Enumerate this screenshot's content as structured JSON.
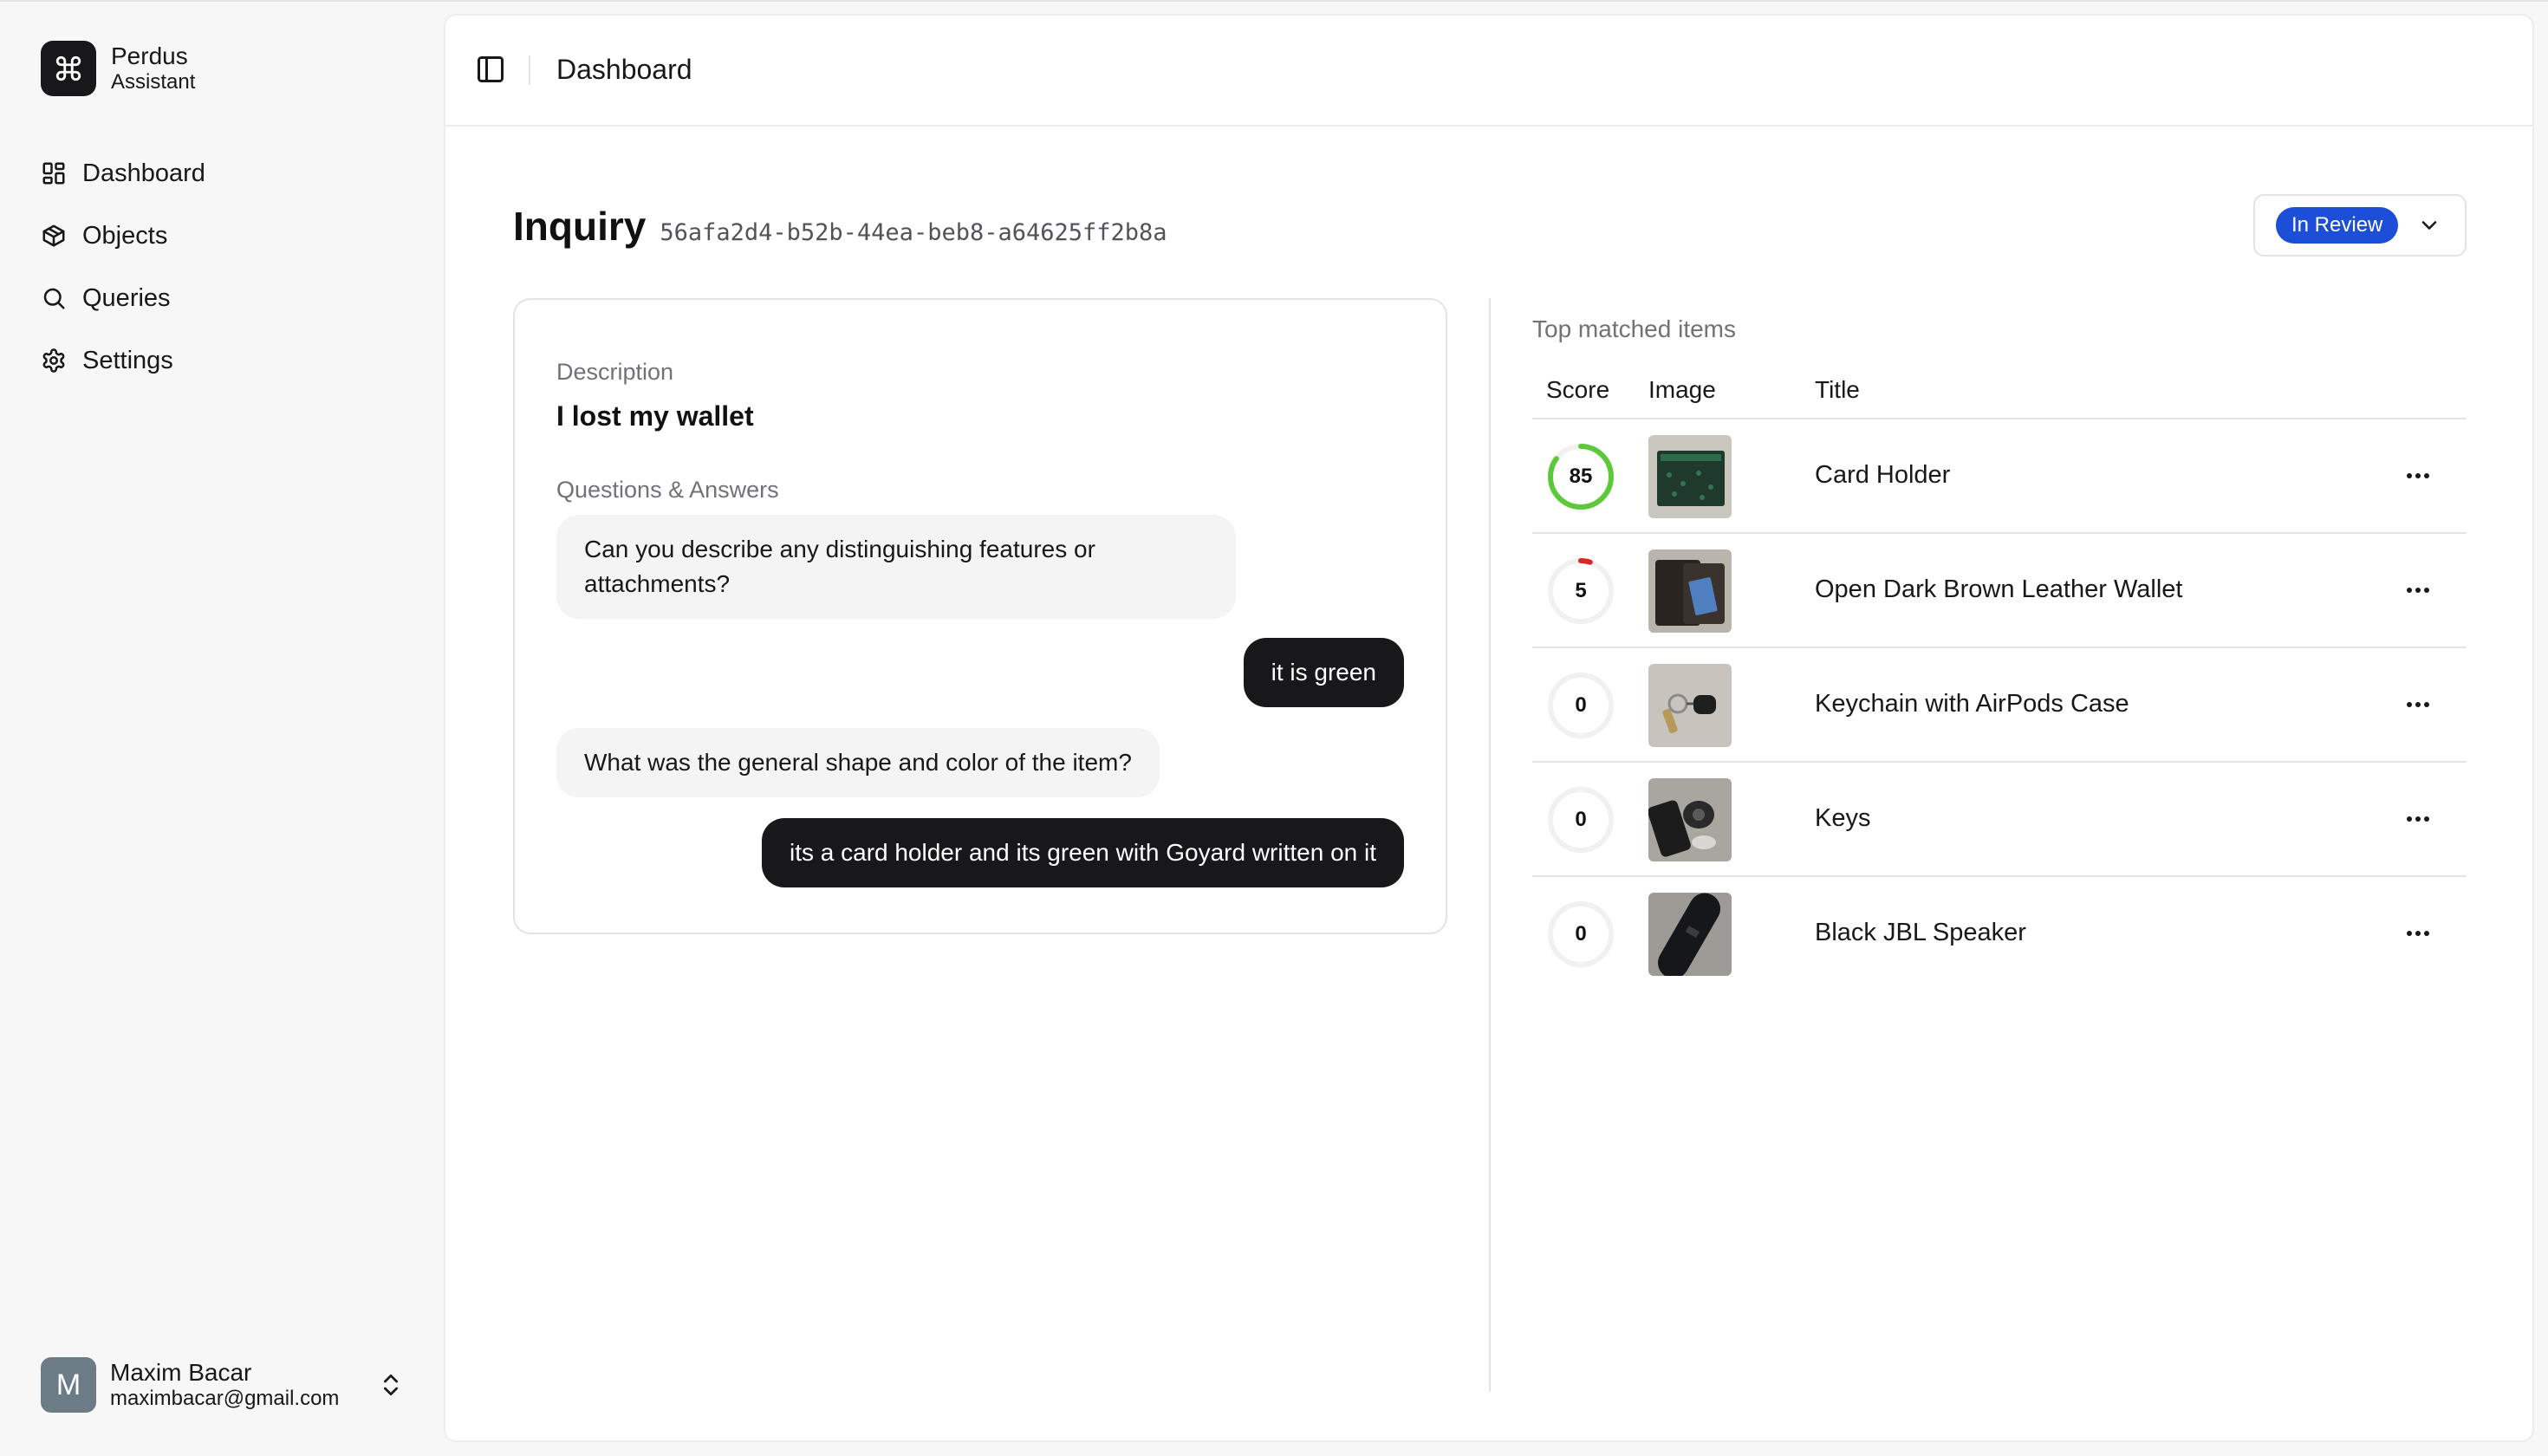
{
  "app": {
    "name": "Perdus",
    "subtitle": "Assistant",
    "logo_icon": "command-icon"
  },
  "nav": [
    {
      "label": "Dashboard",
      "icon": "dashboard-icon"
    },
    {
      "label": "Objects",
      "icon": "box-icon"
    },
    {
      "label": "Queries",
      "icon": "search-icon"
    },
    {
      "label": "Settings",
      "icon": "gear-icon"
    }
  ],
  "user": {
    "initial": "M",
    "name": "Maxim Bacar",
    "email": "maximbacar@gmail.com"
  },
  "topbar": {
    "title": "Dashboard"
  },
  "inquiry": {
    "label": "Inquiry",
    "id": "56afa2d4-b52b-44ea-beb8-a64625ff2b8a",
    "status": "In Review",
    "status_color": "#1d4ed8"
  },
  "description": {
    "label": "Description",
    "text": "I lost my wallet",
    "qa_label": "Questions & Answers",
    "messages": [
      {
        "role": "question",
        "text": "Can you describe any distinguishing features or attachments?"
      },
      {
        "role": "answer",
        "text": "it is green"
      },
      {
        "role": "question",
        "text": "What was the general shape and color of the item?"
      },
      {
        "role": "answer",
        "text": "its a card holder and its green with Goyard written on it"
      }
    ]
  },
  "matched": {
    "title": "Top matched items",
    "columns": [
      "Score",
      "Image",
      "Title"
    ],
    "items": [
      {
        "score": 85,
        "title": "Card Holder",
        "image": "card-holder-photo",
        "score_color": "#5cc93b"
      },
      {
        "score": 5,
        "title": "Open Dark Brown Leather Wallet",
        "image": "wallet-photo",
        "score_color": "#dc2626"
      },
      {
        "score": 0,
        "title": "Keychain with AirPods Case",
        "image": "keychain-photo",
        "score_color": "#dc2626"
      },
      {
        "score": 0,
        "title": "Keys",
        "image": "keys-photo",
        "score_color": "#dc2626"
      },
      {
        "score": 0,
        "title": "Black JBL Speaker",
        "image": "speaker-photo",
        "score_color": "#dc2626"
      }
    ]
  }
}
